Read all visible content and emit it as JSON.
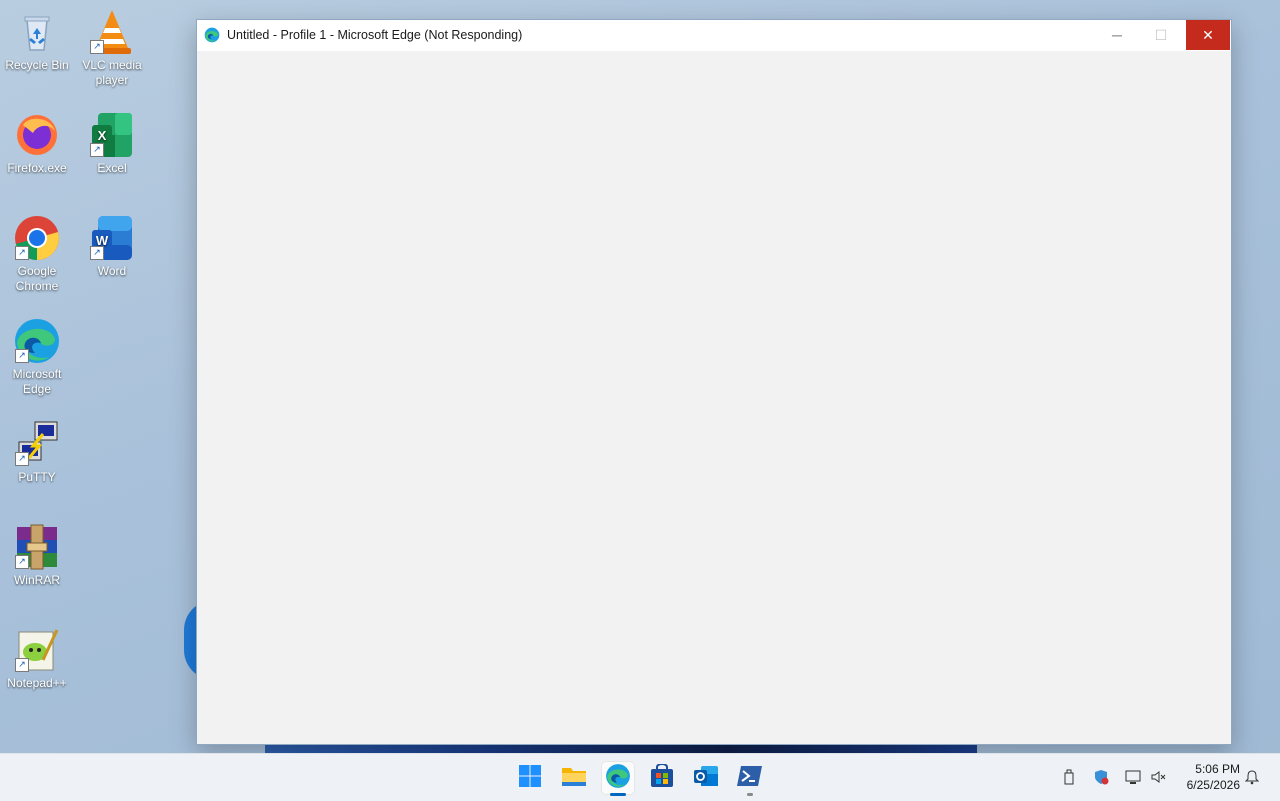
{
  "desktop": {
    "icons": [
      {
        "label": "Recycle Bin",
        "icon": "recycle-bin-icon"
      },
      {
        "label": "VLC media player",
        "icon": "vlc-icon"
      },
      {
        "label": "Firefox.exe",
        "icon": "firefox-icon"
      },
      {
        "label": "Excel",
        "icon": "excel-icon"
      },
      {
        "label": "Google Chrome",
        "icon": "chrome-icon"
      },
      {
        "label": "Word",
        "icon": "word-icon"
      },
      {
        "label": "Microsoft Edge",
        "icon": "edge-icon"
      },
      {
        "label": "PuTTY",
        "icon": "putty-icon"
      },
      {
        "label": "WinRAR",
        "icon": "winrar-icon"
      },
      {
        "label": "Notepad++",
        "icon": "notepadpp-icon"
      }
    ]
  },
  "window": {
    "title": "Untitled - Profile 1 - Microsoft Edge (Not Responding)",
    "controls": {
      "minimize": "─",
      "maximize": "☐",
      "close": "✕"
    }
  },
  "taskbar": {
    "apps": [
      {
        "name": "Start",
        "icon": "windows-start-icon"
      },
      {
        "name": "File Explorer",
        "icon": "file-explorer-icon"
      },
      {
        "name": "Microsoft Edge",
        "icon": "edge-icon",
        "active": true
      },
      {
        "name": "Microsoft Store",
        "icon": "store-icon"
      },
      {
        "name": "Outlook",
        "icon": "outlook-icon"
      },
      {
        "name": "PowerShell",
        "icon": "powershell-icon"
      }
    ],
    "tray": {
      "time": "5:06 PM",
      "date": "6/25/2026"
    }
  },
  "colors": {
    "close_red": "#c42b1c",
    "accent": "#0067c0"
  }
}
